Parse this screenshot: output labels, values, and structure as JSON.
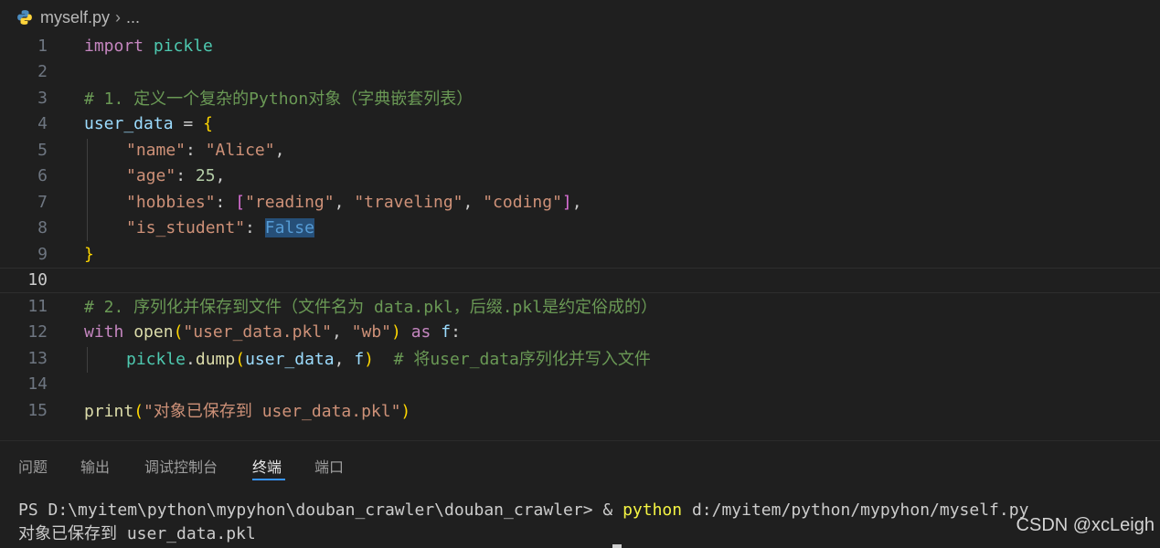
{
  "breadcrumb": {
    "file": "myself.py",
    "separator": "›",
    "more": "..."
  },
  "editor": {
    "current_line": 10,
    "line_numbers": [
      "1",
      "2",
      "3",
      "4",
      "5",
      "6",
      "7",
      "8",
      "9",
      "10",
      "11",
      "12",
      "13",
      "14",
      "15"
    ],
    "tokens": {
      "l1": [
        "import",
        "pickle"
      ],
      "l3": "# 1. 定义一个复杂的Python对象（字典嵌套列表）",
      "l4": [
        "user_data",
        " = ",
        "{"
      ],
      "l5": [
        "\"name\"",
        ": ",
        "\"Alice\"",
        ","
      ],
      "l6": [
        "\"age\"",
        ": ",
        "25",
        ","
      ],
      "l7": [
        "\"hobbies\"",
        ": ",
        "[",
        "\"reading\"",
        ", ",
        "\"traveling\"",
        ", ",
        "\"coding\"",
        "]",
        ","
      ],
      "l8": [
        "\"is_student\"",
        ": ",
        "False"
      ],
      "l9": "}",
      "l11": "# 2. 序列化并保存到文件（文件名为 data.pkl，后缀.pkl是约定俗成的）",
      "l12": [
        "with",
        "open",
        "(",
        "\"user_data.pkl\"",
        ", ",
        "\"wb\"",
        ")",
        "as",
        "f",
        ":"
      ],
      "l13": [
        "pickle",
        ".",
        "dump",
        "(",
        "user_data",
        ", ",
        "f",
        ")",
        "  # 将user_data序列化并写入文件"
      ],
      "l15": [
        "print",
        "(",
        "\"对象已保存到 user_data.pkl\"",
        ")"
      ]
    }
  },
  "panel": {
    "tabs": [
      "问题",
      "输出",
      "调试控制台",
      "终端",
      "端口"
    ],
    "active_tab": "终端"
  },
  "terminal": {
    "prompt": "PS D:\\myitem\\python\\mypyhon\\douban_crawler\\douban_crawler> ",
    "amp": "& ",
    "command": "python",
    "arg": " d:/myitem/python/mypyhon/myself.py",
    "output": "对象已保存到 user_data.pkl"
  },
  "watermark": "CSDN @xcLeigh"
}
